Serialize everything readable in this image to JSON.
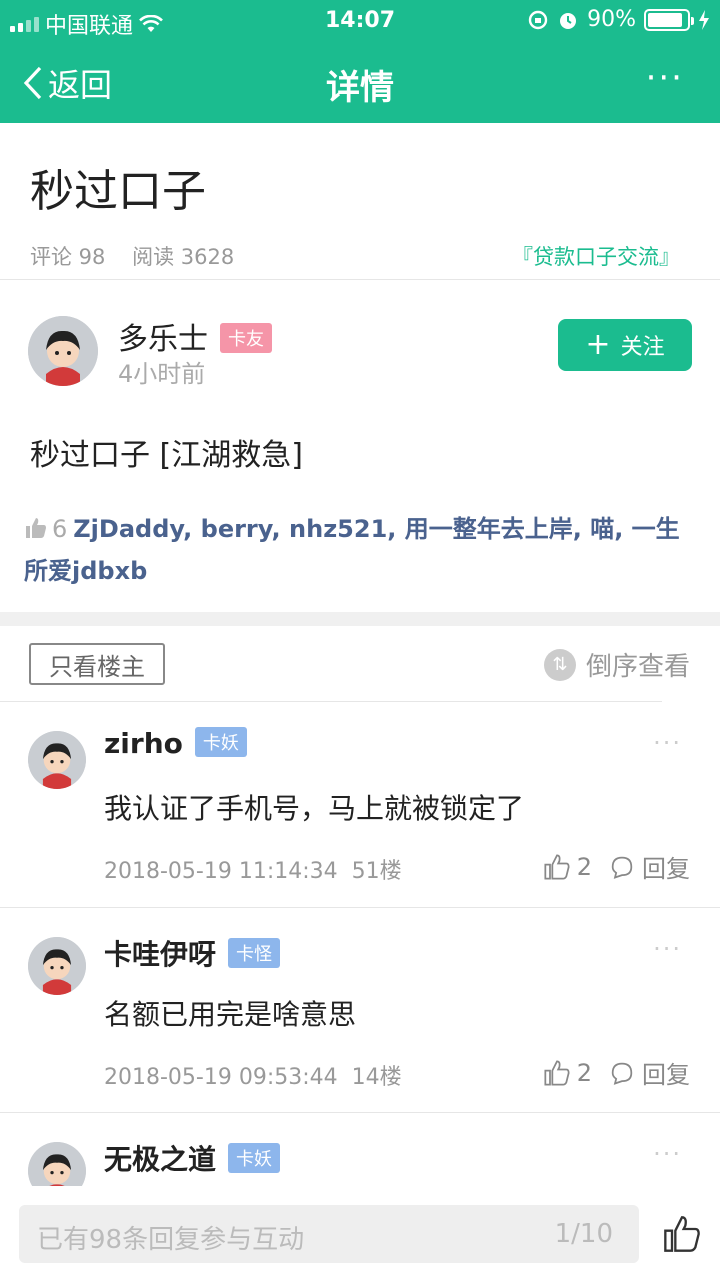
{
  "status_bar": {
    "carrier": "中国联通",
    "time": "14:07",
    "battery": "90%",
    "battery_level": 0.9
  },
  "nav": {
    "back_label": "返回",
    "title": "详情",
    "more": "···"
  },
  "post": {
    "title": "秒过口子",
    "comments": "评论 98",
    "reads": "阅读 3628",
    "topic": "『贷款口子交流』",
    "author": {
      "name": "多乐士",
      "badge": "卡友",
      "time": "4小时前",
      "follow_label": "关注"
    },
    "content": "秒过口子  [江湖救急]",
    "likes": {
      "count": "6",
      "users": "ZjDaddy, berry, nhz521, 用一整年去上岸, 喵, 一生所爱jdbxb"
    }
  },
  "filter": {
    "only_owner": "只看楼主",
    "reverse": "倒序查看"
  },
  "comments": [
    {
      "name": "zirho",
      "badge": "卡妖",
      "text": "我认证了手机号，马上就被锁定了",
      "date": "2018-05-19 11:14:34",
      "floor": "51楼",
      "likes": "2",
      "reply": "回复"
    },
    {
      "name": "卡哇伊呀",
      "badge": "卡怪",
      "text": "名额已用完是啥意思",
      "date": "2018-05-19 09:53:44",
      "floor": "14楼",
      "likes": "2",
      "reply": "回复"
    },
    {
      "name": "无极之道",
      "badge": "卡妖"
    }
  ],
  "bottom": {
    "placeholder": "已有98条回复参与互动",
    "page": "1/10"
  }
}
